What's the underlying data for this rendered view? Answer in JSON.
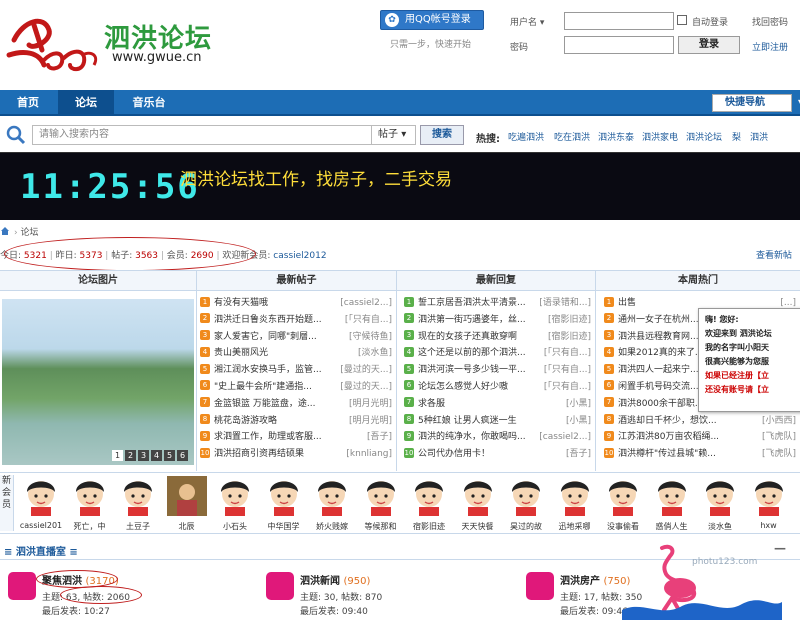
{
  "header": {
    "logo_cn": "泗洪论坛",
    "logo_url": "www.gwue.cn",
    "qq_login": "用QQ帐号登录",
    "qq_sub": "只需一步，快速开始",
    "username_label": "用户名",
    "password_label": "密码",
    "auto_login": "自动登录",
    "forgot_password": "找回密码",
    "login_button": "登录",
    "register": "立即注册"
  },
  "nav": {
    "items": [
      "首页",
      "论坛",
      "音乐台"
    ],
    "active": "论坛",
    "quick_nav": "快捷导航"
  },
  "search": {
    "placeholder": "请输入搜索内容",
    "type": "帖子",
    "button": "搜索",
    "hot_label": "热搜:",
    "hot": [
      "吃遍泗洪",
      "吃在泗洪",
      "泗洪东泰",
      "泗洪家电",
      "泗洪论坛",
      "梨",
      "泗洪"
    ]
  },
  "banner": {
    "clock": "11:25:56",
    "text": "泗洪论坛找工作，找房子，二手交易"
  },
  "breadcrumb": "论坛",
  "stats": {
    "today_label": "今日:",
    "today": "5321",
    "yesterday_label": "昨日:",
    "yesterday": "5373",
    "posts_label": "帖子:",
    "posts": "3563",
    "members_label": "会员:",
    "members": "2690",
    "welcome_label": "欢迎新会员:",
    "newest_member": "cassiel2012",
    "view_new": "查看新帖"
  },
  "columns": {
    "pics": "论坛图片",
    "latest": "最新帖子",
    "replies": "最新回复",
    "hot": "本周热门"
  },
  "pic_tabs": [
    "1",
    "2",
    "3",
    "4",
    "5",
    "6"
  ],
  "latest_posts": [
    {
      "title": "有没有天猫哦",
      "author": "[cassiel2...]"
    },
    {
      "title": "泗洪迁日鲁炎东西开始题...",
      "author": "[「只有自...]"
    },
    {
      "title": "家人爱害它，同哪\"刺層...",
      "author": "[守候待鱼]"
    },
    {
      "title": "贵山美丽风光",
      "author": "[淡水鱼]"
    },
    {
      "title": "湘江润水安换马手，监管...",
      "author": "[曼过的天...]"
    },
    {
      "title": "\"史上最牛会所\"建通指...",
      "author": "[曼过的天...]"
    },
    {
      "title": "金篮银篮 万能篮盘，途...",
      "author": "[明月光明]"
    },
    {
      "title": "桃花岛游游攻略",
      "author": "[明月光明]"
    },
    {
      "title": "求泗置工作，助理或客服...",
      "author": "[吾子]"
    },
    {
      "title": "泗洪招商引资再结硕果",
      "author": "[knnliang]"
    }
  ],
  "latest_replies": [
    {
      "title": "誓工京居吾泗洪太平清景...",
      "author": "[语录错和...]"
    },
    {
      "title": "泗洪第一街巧遇婆年，丝...",
      "author": "[宿影旧迹]"
    },
    {
      "title": "现在的女孩子还真敢穿啊",
      "author": "[宿影旧迹]"
    },
    {
      "title": "这个还是以前的那个泗洪...",
      "author": "[「只有自...]"
    },
    {
      "title": "泗洪河滨一号多少钱一平...",
      "author": "[「只有自...]"
    },
    {
      "title": "论坛怎么感觉人好少嗷",
      "author": "[「只有自...]"
    },
    {
      "title": "求各服",
      "author": "[小黑]"
    },
    {
      "title": "5种红娘 让男人疯迷一生",
      "author": "[小黑]"
    },
    {
      "title": "泗洪的纯净水，你敢喝吗...",
      "author": "[cassiel2...]"
    },
    {
      "title": "公司代办信用卡！",
      "author": "[吾子]"
    }
  ],
  "hot_posts": [
    {
      "title": "出售",
      "author": "[...]"
    },
    {
      "title": "通州一女子在杭州...",
      "author": ""
    },
    {
      "title": "泗洪县远程教育网...",
      "author": ""
    },
    {
      "title": "如果2012真的来了...",
      "author": ""
    },
    {
      "title": "泗洪四人一起来宁...",
      "author": ""
    },
    {
      "title": "闲置手机号码交流...",
      "author": ""
    },
    {
      "title": "泗洪8000余干部职...",
      "author": ""
    },
    {
      "title": "酒逃却日千杯少，想饮...",
      "author": "[小西西]"
    },
    {
      "title": "江苏泗洪80万亩农稻绳...",
      "author": "[飞虎队]"
    },
    {
      "title": "泗洪樽杆\"传过县城\"赖...",
      "author": "[飞虎队]"
    }
  ],
  "popup": {
    "line1": "嗨! 您好:",
    "line2": "欢迎来到 泗洪论坛",
    "line3": "我的名字叫小阳天",
    "line4": "很高兴能够为您服",
    "line5": "如果已经注册【立",
    "line6": "还没有账号请【立"
  },
  "members_label": "新会员",
  "members": [
    "cassiel201",
    "死亡，中",
    "土豆子",
    "北辰",
    "小石头",
    "中华国学",
    "娇火贱嫁",
    "等候那和",
    "宿影旧迹",
    "天天快餐",
    "昊过的故",
    "迅地采哪",
    "没事偷看",
    "惑俏人生",
    "淡水鱼",
    "hxw"
  ],
  "section": {
    "title": "泗洪直播室",
    "minimize": "—"
  },
  "forums": [
    {
      "name": "聚焦泗洪",
      "count": "(3170)",
      "topics_label": "主题:",
      "topics": "63",
      "posts_label": "帖数:",
      "posts": "2060",
      "last_label": "最后发表:",
      "last": "10:27"
    },
    {
      "name": "泗洪新闻",
      "count": "(950)",
      "topics_label": "主题:",
      "topics": "30",
      "posts_label": "帖数:",
      "posts": "870",
      "last_label": "最后发表:",
      "last": "09:40"
    },
    {
      "name": "泗洪房产",
      "count": "(750)",
      "topics_label": "主题:",
      "topics": "17",
      "posts_label": "帖数:",
      "posts": "350",
      "last_label": "最后发表:",
      "last": "09:46"
    }
  ],
  "watermark": "photu123.com",
  "colors": {
    "nav": "#1d6db5",
    "accent": "#2e9a3e",
    "banner_text": "#ffde3a",
    "clock": "#3fe9e9"
  }
}
